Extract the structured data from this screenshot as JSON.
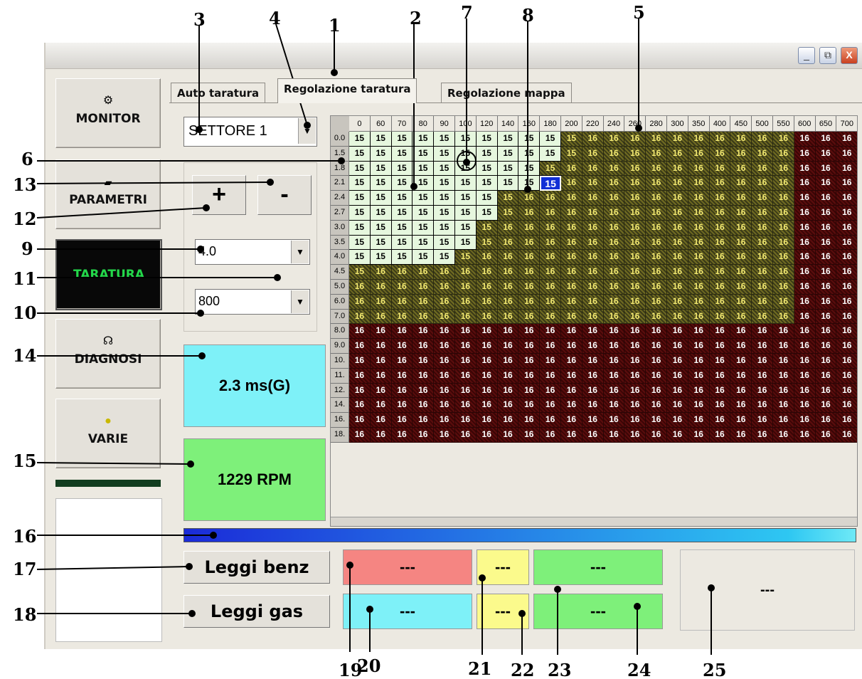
{
  "window": {
    "minimize_glyph": "_",
    "restore_glyph": "⧉",
    "close_glyph": "X"
  },
  "sidebar": {
    "items": [
      {
        "label": "MONITOR",
        "icon": "gear-icon"
      },
      {
        "label": "PARAMETRI",
        "icon": "chip-icon"
      },
      {
        "label": "TARATURA",
        "icon": "none"
      },
      {
        "label": "DIAGNOSI",
        "icon": "stethoscope-icon"
      },
      {
        "label": "VARIE",
        "icon": "coin-icon"
      }
    ]
  },
  "tabs": [
    {
      "label": "Auto taratura"
    },
    {
      "label": "Regolazione taratura",
      "active": true
    },
    {
      "label": "Regolazione mappa"
    }
  ],
  "controls": {
    "sector_value": "SETTORE 1",
    "plus_label": "+",
    "minus_label": "-",
    "step_value": "4.0",
    "rpm_step_value": "800",
    "dropdown_glyph": "▼"
  },
  "displays": {
    "injection_time": "2.3 ms(G)",
    "rpm": "1229 RPM",
    "injection_color": "#7ef1f8",
    "rpm_color": "#7ef07a"
  },
  "map": {
    "columns": [
      "0",
      "60",
      "70",
      "80",
      "90",
      "100",
      "120",
      "140",
      "160",
      "180",
      "200",
      "220",
      "240",
      "260",
      "280",
      "300",
      "350",
      "400",
      "450",
      "500",
      "550",
      "600",
      "650",
      "700"
    ],
    "rows": [
      "0.0",
      "1.5",
      "1.8",
      "2.1",
      "2.4",
      "2.7",
      "3.0",
      "3.5",
      "4.0",
      "4.5",
      "5.0",
      "6.0",
      "7.0",
      "8.0",
      "9.0",
      "10.",
      "11.",
      "12.",
      "14.",
      "16.",
      "18."
    ],
    "selected": {
      "row": 3,
      "col": 9,
      "value": "15"
    },
    "colors": {
      "light": "#e6f7de",
      "olive": "#6f6a21",
      "red": "#5a0d0d",
      "selected": "#1230d6"
    }
  },
  "readings": {
    "leggi_benz": "Leggi benz",
    "leggi_gas": "Leggi gas",
    "benz_value": "---",
    "benz_small": "---",
    "benz_right": "---",
    "gas_value": "---",
    "gas_small": "---",
    "gas_right": "---",
    "side_value": "---"
  },
  "annotations": [
    "1",
    "2",
    "3",
    "4",
    "5",
    "6",
    "7",
    "8",
    "9",
    "10",
    "11",
    "12",
    "13",
    "14",
    "15",
    "16",
    "17",
    "18",
    "19",
    "20",
    "21",
    "22",
    "23",
    "24",
    "25"
  ]
}
